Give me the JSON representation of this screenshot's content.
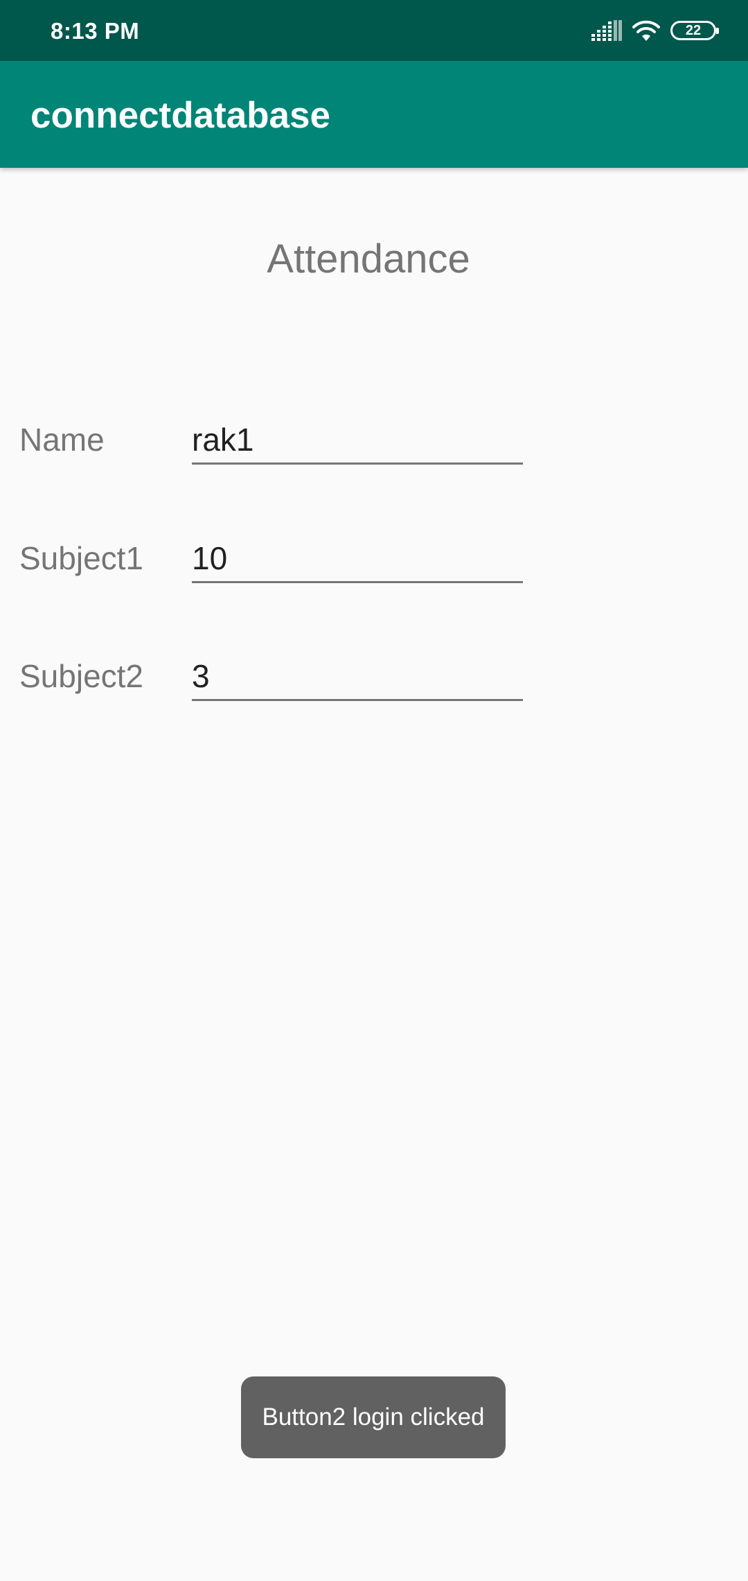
{
  "status_bar": {
    "time": "8:13 PM",
    "icons": [
      "signal-icon",
      "wifi-icon",
      "battery-icon"
    ],
    "battery_level": "22"
  },
  "app_bar": {
    "title": "connectdatabase",
    "color": "#008577"
  },
  "form": {
    "heading": "Attendance",
    "fields": [
      {
        "label": "Name",
        "value": "rak1"
      },
      {
        "label": "Subject1",
        "value": "10"
      },
      {
        "label": "Subject2",
        "value": "3"
      }
    ]
  },
  "toast": {
    "message": "Button2 login clicked"
  },
  "colors": {
    "status_bar": "#00574b",
    "app_bar": "#008577",
    "background": "#fafafa",
    "toast": "#616161"
  }
}
